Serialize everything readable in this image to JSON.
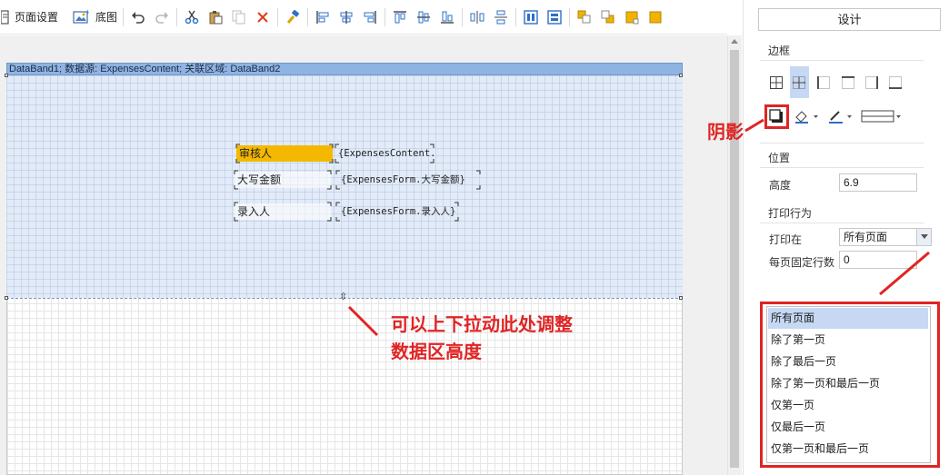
{
  "toolbar": {
    "page_setup_label": "页面设置",
    "background_label": "底图"
  },
  "band": {
    "header": "DataBand1; 数据源: ExpensesContent; 关联区域: DataBand2",
    "fields": [
      {
        "label": "审核人",
        "value": "{ExpensesContent."
      },
      {
        "label": "大写金额",
        "value": "{ExpensesForm.大写金额}"
      },
      {
        "label": "录入人",
        "value": "{ExpensesForm.录入人}"
      }
    ]
  },
  "annotations": {
    "resize_line1": "可以上下拉动此处调整",
    "resize_line2": "数据区高度",
    "shadow": "阴影"
  },
  "panel": {
    "design_button": "设计",
    "border_title": "边框",
    "position_title": "位置",
    "height_label": "高度",
    "height_value": "6.9",
    "print_behavior_title": "打印行为",
    "print_on_label": "打印在",
    "print_on_value": "所有页面",
    "fixed_rows_label": "每页固定行数",
    "fixed_rows_value": "0"
  },
  "dropdown": {
    "options": [
      "所有页面",
      "除了第一页",
      "除了最后一页",
      "除了第一页和最后一页",
      "仅第一页",
      "仅最后一页",
      "仅第一页和最后一页"
    ],
    "selected_index": 0
  },
  "colors": {
    "annotation_red": "#e02424",
    "band_header": "#8fb4e3",
    "band_body": "#e2ebf7",
    "selected_field": "#f5b800",
    "dropdown_highlight": "#c6d8f3",
    "accent_blue": "#2e6fc7"
  }
}
